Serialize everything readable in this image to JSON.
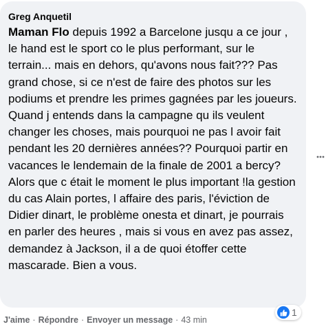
{
  "comment": {
    "author": "Greg Anquetil",
    "mention": "Maman Flo",
    "text": " depuis 1992 a Barcelone jusqu a ce jour , le hand est le sport co le plus performant, sur le terrain... mais en dehors, qu'avons nous fait??? Pas grand chose, si ce n'est de faire des photos sur les podiums et prendre les primes gagnées par les joueurs. Quand j entends dans la campagne qu ils veulent changer les choses, mais pourquoi ne pas l avoir fait pendant les 20 dernières années?? Pourquoi partir en vacances le lendemain de la finale de 2001 a bercy? Alors que c était le moment le plus important !la gestion du cas Alain portes, l affaire des paris, l'éviction de Didier dinart, le problème onesta et dinart, je pourrais en parler des heures , mais si vous en avez pas assez, demandez à Jackson, il a de quoi étoffer cette mascarade. Bien a vous."
  },
  "reactions": {
    "icon": "like-icon",
    "count": "1",
    "color": "#1877f2"
  },
  "actions": {
    "like_label": "J'aime",
    "reply_label": "Répondre",
    "message_label": "Envoyer un message",
    "separator": "·",
    "timestamp": "43 min"
  },
  "more_icon": "more-horizontal-icon",
  "colors": {
    "bubble": "#f0f2f5",
    "text": "#050505",
    "secondary": "#65676b"
  }
}
